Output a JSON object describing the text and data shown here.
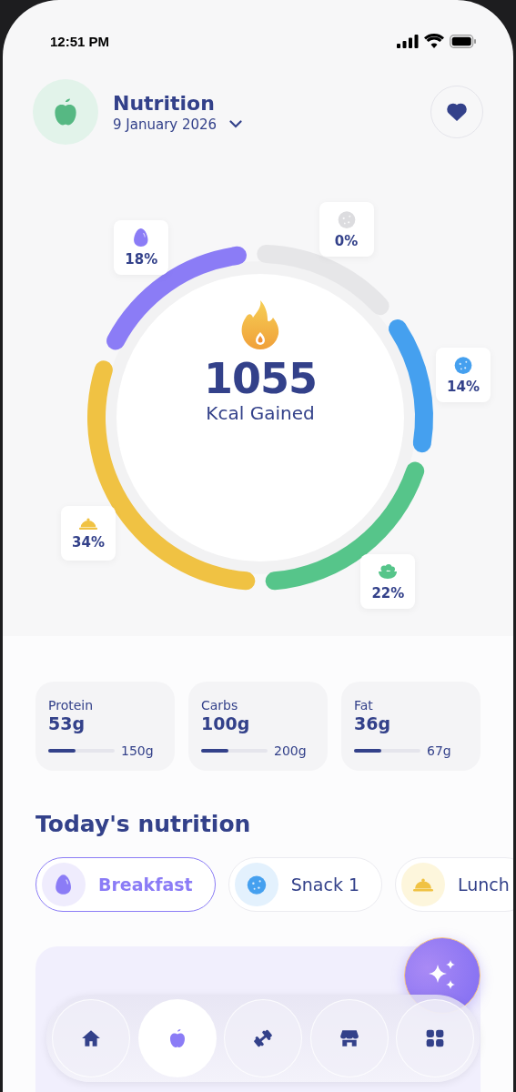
{
  "status_bar": {
    "time": "12:51 PM"
  },
  "header": {
    "title": "Nutrition",
    "date": "9 January 2026",
    "favorite": true
  },
  "ring": {
    "value": "1055",
    "caption": "Kcal Gained",
    "segments": [
      {
        "kind": "egg",
        "label": "18%",
        "color": "#8b7cf6"
      },
      {
        "kind": "cookie",
        "label": "0%",
        "color": "#e6e6e8"
      },
      {
        "kind": "cookie",
        "label": "14%",
        "color": "#45a0ef"
      },
      {
        "kind": "bowl",
        "label": "22%",
        "color": "#56c58a"
      },
      {
        "kind": "cloche",
        "label": "34%",
        "color": "#f0c243"
      }
    ]
  },
  "macros": [
    {
      "name": "Protein",
      "value": "53g",
      "goal": "150g",
      "level": 0.41
    },
    {
      "name": "Carbs",
      "value": "100g",
      "goal": "200g",
      "level": 0.41
    },
    {
      "name": "Fat",
      "value": "36g",
      "goal": "67g",
      "level": 0.41
    }
  ],
  "section_title": "Today's nutrition",
  "meals": [
    {
      "kind": "egg",
      "label": "Breakfast",
      "selected": true
    },
    {
      "kind": "cookie",
      "label": "Snack 1",
      "selected": false
    },
    {
      "kind": "cloche",
      "label": "Lunch",
      "selected": false
    }
  ],
  "nav": [
    {
      "kind": "home",
      "selected": false
    },
    {
      "kind": "apple",
      "selected": true
    },
    {
      "kind": "dumbbell",
      "selected": false
    },
    {
      "kind": "store",
      "selected": false
    },
    {
      "kind": "grid",
      "selected": false
    }
  ]
}
